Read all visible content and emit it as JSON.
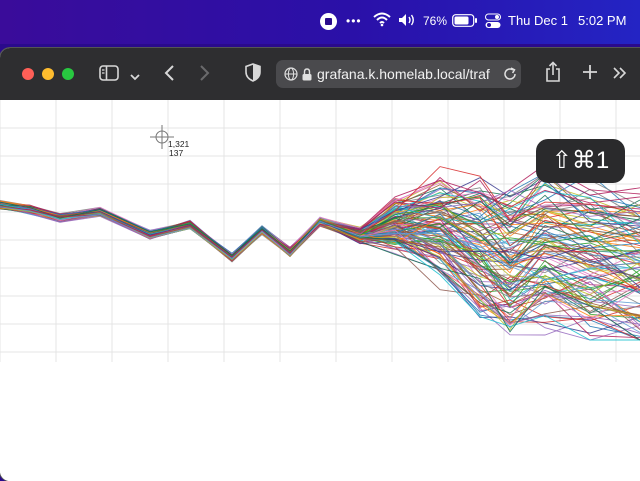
{
  "menubar": {
    "battery_percent": "76%",
    "date": "Thu Dec 1",
    "time": "5:02 PM",
    "more_glyph": "•••"
  },
  "browser": {
    "url": "grafana.k.homelab.local/traf"
  },
  "chart": {
    "crosshair_x_readout": "1,321",
    "crosshair_y_readout": "137"
  },
  "hud": {
    "shortcut": "⇧⌘1"
  },
  "colors": {
    "menubar": "#3a0c9a",
    "toolbar": "#2e2e30",
    "url_field": "#4a4a4d",
    "close": "#ff5f57",
    "minimize": "#febc2e",
    "zoom": "#28c840"
  },
  "chart_data": {
    "type": "line",
    "grid": true,
    "series_count": 120,
    "note_visible_text": [
      "1,321",
      "137"
    ]
  }
}
